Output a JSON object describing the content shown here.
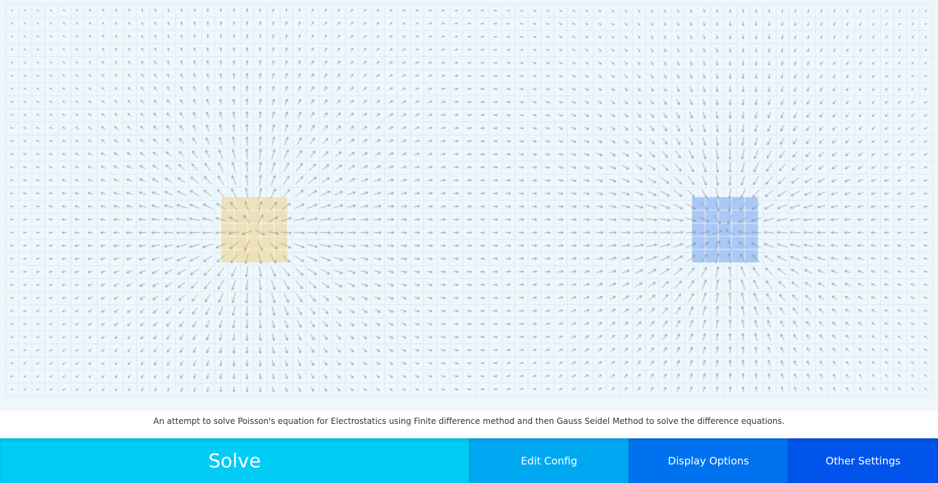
{
  "description": "An attempt to solve Poisson's equation for Electrostatics using Finite difference method and then Gauss Seidel Method to solve the difference equations.",
  "toolbar": {
    "solve_label": "Solve",
    "edit_config_label": "Edit Config",
    "display_options_label": "Display Options",
    "other_settings_label": "Other Settings"
  },
  "colors": {
    "background": "#eef8fc",
    "grid_line": "#d7ecf3",
    "arrow": "#8a8f94",
    "positive_charge": "#eee0b8",
    "negative_charge": "#a9c8f5",
    "solve": "#00ccf5",
    "edit_config": "#00a8f2",
    "display_options": "#0072f0",
    "other_settings": "#0053eb"
  },
  "charges": [
    {
      "name": "positive-charge",
      "sign": 1
    },
    {
      "name": "negative-charge",
      "sign": -1
    }
  ]
}
